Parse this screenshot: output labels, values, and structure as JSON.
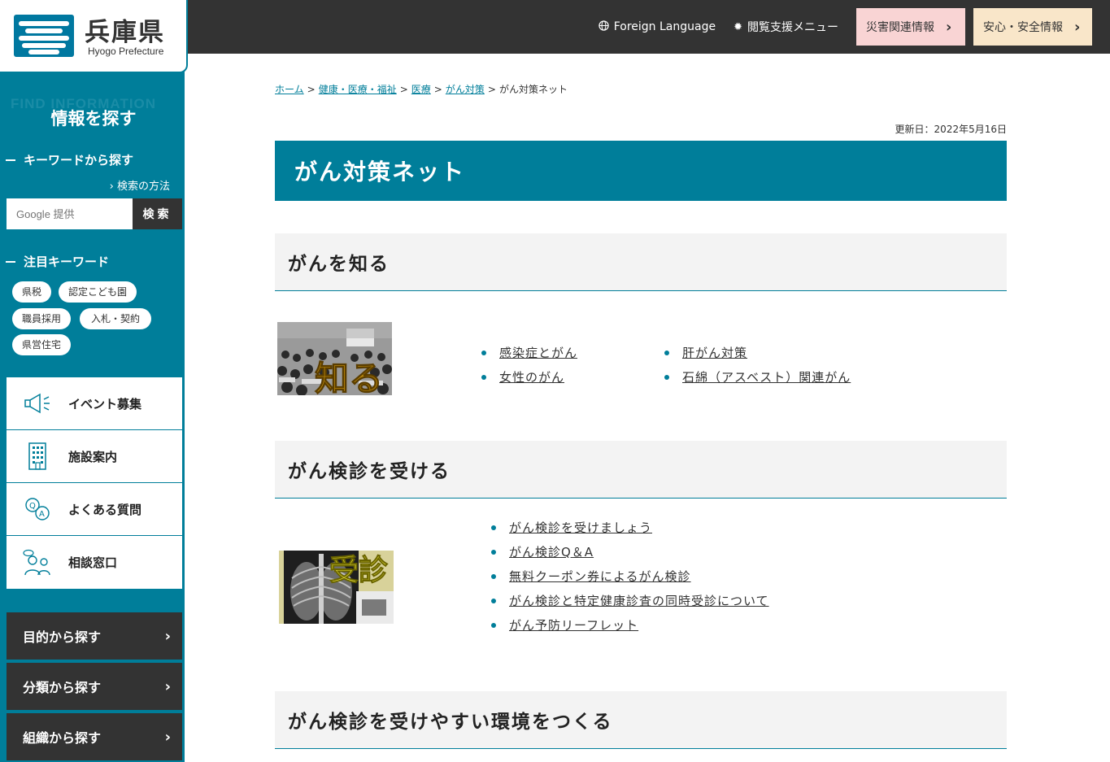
{
  "header": {
    "logo_ja": "兵庫県",
    "logo_en": "Hyogo Prefecture",
    "foreign_language": "Foreign Language",
    "accessibility_menu": "閲覧支援メニュー",
    "disaster_info": "災害関連情報",
    "safety_info": "安心・安全情報"
  },
  "sidebar": {
    "find_bg": "FIND INFORMATION",
    "find_title": "情報を探す",
    "keyword_heading": "キーワードから探す",
    "how_to_search": "検索の方法",
    "search_placeholder": "Google 提供",
    "search_button": "検索",
    "featured_heading": "注目キーワード",
    "keywords": [
      "県税",
      "認定こども園",
      "職員採用",
      "入札・契約",
      "県営住宅"
    ],
    "cards": [
      {
        "label": "イベント募集",
        "icon": "megaphone-icon"
      },
      {
        "label": "施設案内",
        "icon": "building-icon"
      },
      {
        "label": "よくある質問",
        "icon": "qa-icon"
      },
      {
        "label": "相談窓口",
        "icon": "consultation-icon"
      }
    ],
    "nav": [
      "目的から探す",
      "分類から探す",
      "組織から探す"
    ]
  },
  "breadcrumb": {
    "items": [
      "ホーム",
      "健康・医療・福祉",
      "医療",
      "がん対策"
    ],
    "current": "がん対策ネット"
  },
  "updated": "更新日：2022年5月16日",
  "page_title": "がん対策ネット",
  "sections": [
    {
      "heading": "がんを知る",
      "thumb_text": "知る",
      "links_col1": [
        "感染症とがん",
        "女性のがん"
      ],
      "links_col2": [
        "肝がん対策",
        "石綿（アスベスト）関連がん"
      ]
    },
    {
      "heading": "がん検診を受ける",
      "thumb_text": "受診",
      "links": [
        "がん検診を受けましょう",
        "がん検診Q＆A",
        "無料クーポン券によるがん検診",
        "がん検診と特定健康診査の同時受診について",
        "がん予防リーフレット"
      ]
    },
    {
      "heading": "がん検診を受けやすい環境をつくる"
    }
  ],
  "colors": {
    "accent": "#007e9a",
    "dark": "#333333",
    "pink": "#f9d4d4",
    "beige": "#f9e6c9"
  }
}
